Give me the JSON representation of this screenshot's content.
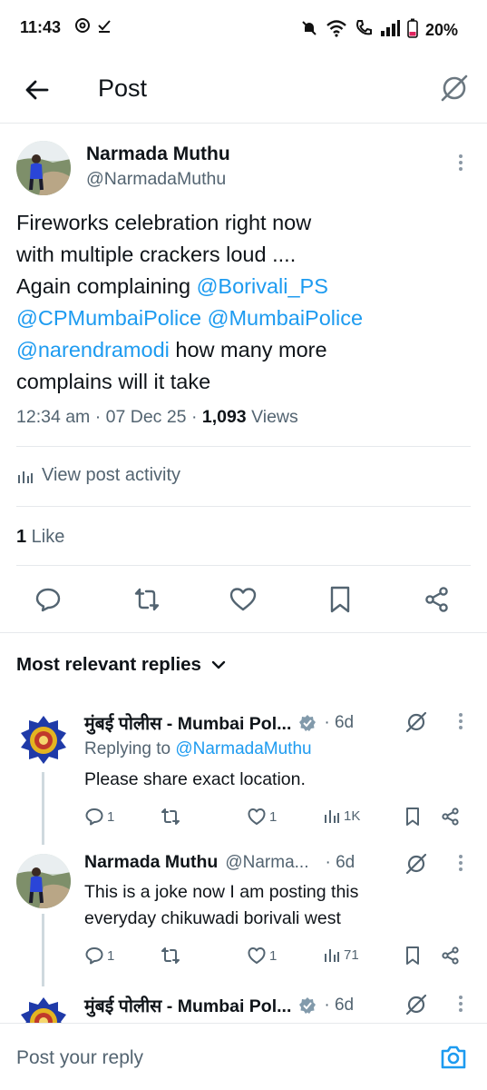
{
  "status_bar": {
    "time": "11:43",
    "battery": "20%"
  },
  "header": {
    "title": "Post"
  },
  "post": {
    "author_name": "Narmada Muthu",
    "author_handle": "@NarmadaMuthu",
    "text_line1": "Fireworks celebration right now",
    "text_line2": "with multiple crackers loud ....",
    "text_line3_plain": "Again complaining ",
    "mention1": "@Borivali_PS",
    "mention2": "@CPMumbaiPolice",
    "mention3": "@MumbaiPolice",
    "mention4": "@narendramodi",
    "text_after_mention4": " how many more",
    "text_line6": "complains will it take",
    "timestamp": "12:34 am · 07 Dec 25 · ",
    "views_count": "1,093",
    "views_label": " Views",
    "view_activity": "View post activity",
    "likes_count": "1",
    "likes_label": " Like"
  },
  "replies_header": "Most relevant replies",
  "replies": [
    {
      "name": "मुंबई पोलीस - Mumbai Pol...",
      "time": "· 6d",
      "replying_label": "Replying to ",
      "replying_to": "@NarmadaMuthu",
      "text": "Please share exact location.",
      "reply_count": "1",
      "retweet_count": "",
      "like_count": "1",
      "views": "1K"
    },
    {
      "name": "Narmada Muthu",
      "handle": "@Narma...",
      "time": "· 6d",
      "text_line1": "This is a joke now I am posting this",
      "text_line2": "everyday chikuwadi borivali west",
      "reply_count": "1",
      "retweet_count": "",
      "like_count": "1",
      "views": "71"
    },
    {
      "name": "मुंबई पोलीस - Mumbai Pol...",
      "time": "· 6d"
    }
  ],
  "compose": {
    "placeholder": "Post your reply"
  },
  "colors": {
    "link": "#1d9bf0",
    "muted": "#536471",
    "text": "#0f1419",
    "verified": "#829aab"
  }
}
